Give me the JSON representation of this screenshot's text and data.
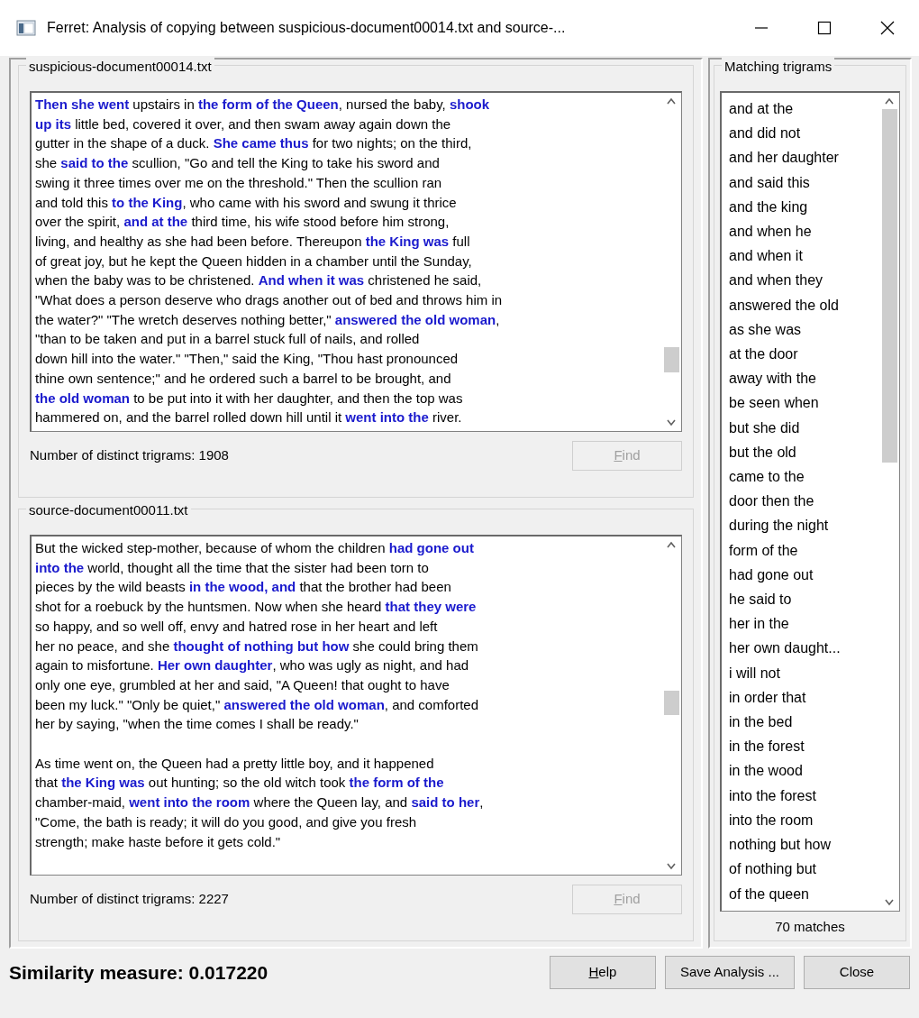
{
  "window": {
    "title": "Ferret: Analysis of copying between suspicious-document00014.txt and source-..."
  },
  "documents": [
    {
      "title": "suspicious-document00014.txt",
      "paragraphs": [
        [
          "**Then she went** upstairs in **the form of the Queen**, nursed the baby, **shook**",
          "**up its** little bed, covered it over, and then swam away again down the",
          "gutter in the shape of a duck. **She came thus** for two nights; on the third,",
          "she **said to the** scullion, \"Go and tell the King to take his sword and",
          "swing it three times over me on the threshold.\" Then the scullion ran",
          "and told this **to the King**, who came with his sword and swung it thrice",
          "over the spirit, **and at the** third time, his wife stood before him strong,",
          "living, and healthy as she had been before. Thereupon **the King was** full",
          "of great joy, but he kept the Queen hidden in a chamber until the Sunday,",
          "when the baby was to be christened. **And when it was** christened he said,",
          "\"What does a person deserve who drags another out of bed and throws him in",
          "the water?\" \"The wretch deserves nothing better,\" **answered the old woman**,",
          "\"than to be taken and put in a barrel stuck full of nails, and rolled",
          "down hill into the water.\" \"Then,\" said the King, \"Thou hast pronounced",
          "thine own sentence;\" and he ordered such a barrel to be brought, and",
          "**the old woman** to be put into it with her daughter, and then the top was",
          "hammered on, and the barrel rolled down hill until it **went into the** river."
        ]
      ],
      "count": "Number of distinct trigrams: 1908",
      "find": {
        "label": "Find",
        "disabled": true,
        "mnemonic": true
      }
    },
    {
      "title": "source-document00011.txt",
      "paragraphs": [
        [
          "But the wicked step-mother, because of whom the children **had gone out**",
          "**into the** world, thought all the time that the sister had been torn to",
          "pieces by the wild beasts **in the wood, and** that the brother had been",
          "shot for a roebuck by the huntsmen. Now when she heard **that they were**",
          "so happy, and so well off, envy and hatred rose in her heart and left",
          "her no peace, and she **thought of nothing but how** she could bring them",
          "again to misfortune. **Her own daughter**, who was ugly as night, and had",
          "only one eye, grumbled at her and said, \"A Queen! that ought to have",
          "been my luck.\" \"Only be quiet,\" **answered the old woman**, and comforted",
          "her by saying, \"when the time comes I shall be ready.\""
        ],
        [
          "As time went on, the Queen had a pretty little boy, and it happened",
          "that **the King was** out hunting; so the old witch took **the form of the**",
          "chamber-maid, **went into the room** where the Queen lay, and **said to her**,",
          "\"Come, the bath is ready; it will do you good, and give you fresh",
          "strength; make haste before it gets cold.\""
        ]
      ],
      "count": "Number of distinct trigrams: 2227",
      "find": {
        "label": "Find",
        "disabled": true,
        "mnemonic": true
      }
    }
  ],
  "matches": {
    "title": "Matching trigrams",
    "items": [
      "and at the",
      "and did not",
      "and her daughter",
      "and said this",
      "and the king",
      "and when he",
      "and when it",
      "and when they",
      "answered the old",
      "as she was",
      "at the door",
      "away with the",
      "be seen when",
      "but she did",
      "but the old",
      "came to the",
      "door then the",
      "during the night",
      "form of the",
      "had gone out",
      "he said to",
      "her in the",
      "her own daught...",
      "i will not",
      "in order that",
      "in the bed",
      "in the forest",
      "in the wood",
      "into the forest",
      "into the room",
      "nothing but how",
      "of nothing but",
      "of the queen"
    ],
    "count": "70 matches"
  },
  "similarity": "Similarity measure: 0.017220",
  "buttons": [
    {
      "label": "Help",
      "mnemonic": true
    },
    {
      "label": "Save Analysis ...",
      "mnemonic": false
    },
    {
      "label": "Close",
      "mnemonic": false
    }
  ]
}
